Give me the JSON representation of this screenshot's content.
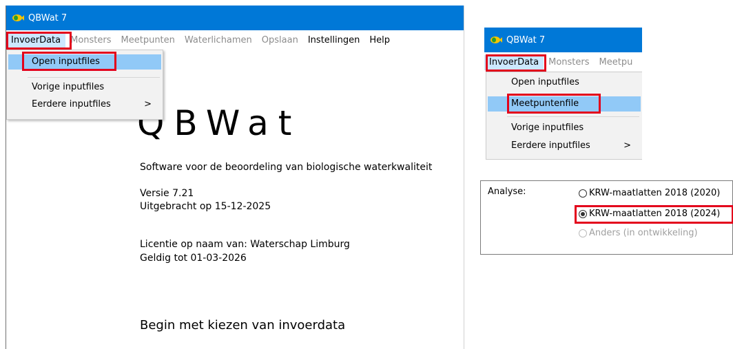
{
  "main_window": {
    "title": "QBWat 7",
    "menu": {
      "invoerdata": "InvoerData",
      "monsters": "Monsters",
      "meetpunten": "Meetpunten",
      "waterlichamen": "Waterlichamen",
      "opslaan": "Opslaan",
      "instellingen": "Instellingen",
      "help": "Help"
    },
    "dropdown": {
      "open_inputfiles": "Open inputfiles",
      "vorige_inputfiles": "Vorige inputfiles",
      "eerdere_inputfiles": "Eerdere inputfiles",
      "submenu_arrow": ">"
    },
    "content": {
      "app_title": "QBWat",
      "description": "Software voor de beoordeling van biologische waterkwaliteit",
      "version": "Versie 7.21",
      "release_date": "Uitgebracht op 15-12-2025",
      "license_holder": "Licentie op naam van: Waterschap Limburg",
      "valid_until": "Geldig tot 01-03-2026",
      "begin_prompt": "Begin met kiezen van invoerdata"
    }
  },
  "second_window": {
    "title": "QBWat 7",
    "menu": {
      "invoerdata": "InvoerData",
      "monsters": "Monsters",
      "meetpunten_partial": "Meetpu"
    },
    "dropdown": {
      "open_inputfiles": "Open inputfiles",
      "meetpuntenfile": "Meetpuntenfile",
      "vorige_inputfiles": "Vorige inputfiles",
      "eerdere_inputfiles": "Eerdere inputfiles",
      "submenu_arrow": ">"
    }
  },
  "analyse_panel": {
    "label": "Analyse:",
    "options": [
      {
        "label": "KRW-maatlatten 2018 (2020)",
        "checked": false,
        "enabled": true
      },
      {
        "label": "KRW-maatlatten 2018 (2024)",
        "checked": true,
        "enabled": true
      },
      {
        "label": "Anders (in ontwikkeling)",
        "checked": false,
        "enabled": false
      }
    ]
  },
  "colors": {
    "titlebar": "#0078d7",
    "highlight_box": "#e3001b",
    "menu_hover": "#91c9f7"
  },
  "icons": {
    "app_icon": "qbwat-fish-icon"
  }
}
